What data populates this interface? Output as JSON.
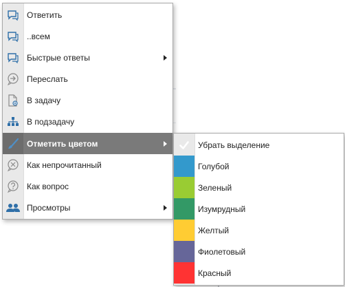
{
  "context_menu": {
    "items": [
      {
        "label": "Ответить",
        "icon": "reply-icon",
        "submenu": false
      },
      {
        "label": "..всем",
        "icon": "reply-all-icon",
        "submenu": false
      },
      {
        "label": "Быстрые ответы",
        "icon": "quick-reply-icon",
        "submenu": true
      },
      {
        "label": "Переслать",
        "icon": "forward-icon",
        "submenu": false
      },
      {
        "label": "В задачу",
        "icon": "to-task-icon",
        "submenu": false
      },
      {
        "label": "В подзадачу",
        "icon": "subtask-icon",
        "submenu": false
      },
      {
        "label": "Отметить цветом",
        "icon": "paintbrush-icon",
        "submenu": true,
        "active": true
      },
      {
        "label": "Как непрочитанный",
        "icon": "mark-unread-icon",
        "submenu": false
      },
      {
        "label": "Как вопрос",
        "icon": "question-icon",
        "submenu": false
      },
      {
        "label": "Просмотры",
        "icon": "viewers-icon",
        "submenu": true
      }
    ]
  },
  "color_submenu": {
    "items": [
      {
        "label": "Убрать выделение",
        "color": "#e9e9e9",
        "icon": "checkmark-icon"
      },
      {
        "label": "Голубой",
        "color": "#3399cc"
      },
      {
        "label": "Зеленый",
        "color": "#99cc33"
      },
      {
        "label": "Изумрудный",
        "color": "#339966"
      },
      {
        "label": "Желтый",
        "color": "#ffcc33"
      },
      {
        "label": "Фиолетовый",
        "color": "#666699"
      },
      {
        "label": "Красный",
        "color": "#ff3333"
      }
    ]
  },
  "theme": {
    "icon_color": "#2f6fa8",
    "active_bg": "#7a7a7a"
  }
}
